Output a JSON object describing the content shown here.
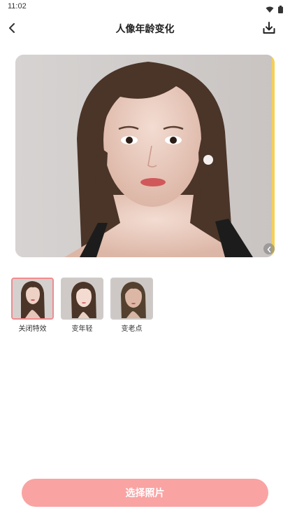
{
  "status_bar": {
    "time": "11:02",
    "icons": [
      "wifi-icon",
      "battery-icon"
    ]
  },
  "app_bar": {
    "title": "人像年龄变化",
    "back_icon": "chevron-left-icon",
    "download_icon": "download-icon"
  },
  "preview": {
    "image": "portrait-photo",
    "compare_handle_icon": "chevron-left-icon",
    "accent_color": "#f3d05a"
  },
  "effects": {
    "items": [
      {
        "label": "关闭特效",
        "selected": true
      },
      {
        "label": "变年轻",
        "selected": false
      },
      {
        "label": "变老点",
        "selected": false
      }
    ],
    "selected_border_color": "#f28a8e"
  },
  "actions": {
    "select_photo_label": "选择照片",
    "button_color": "#f9a3a3"
  }
}
